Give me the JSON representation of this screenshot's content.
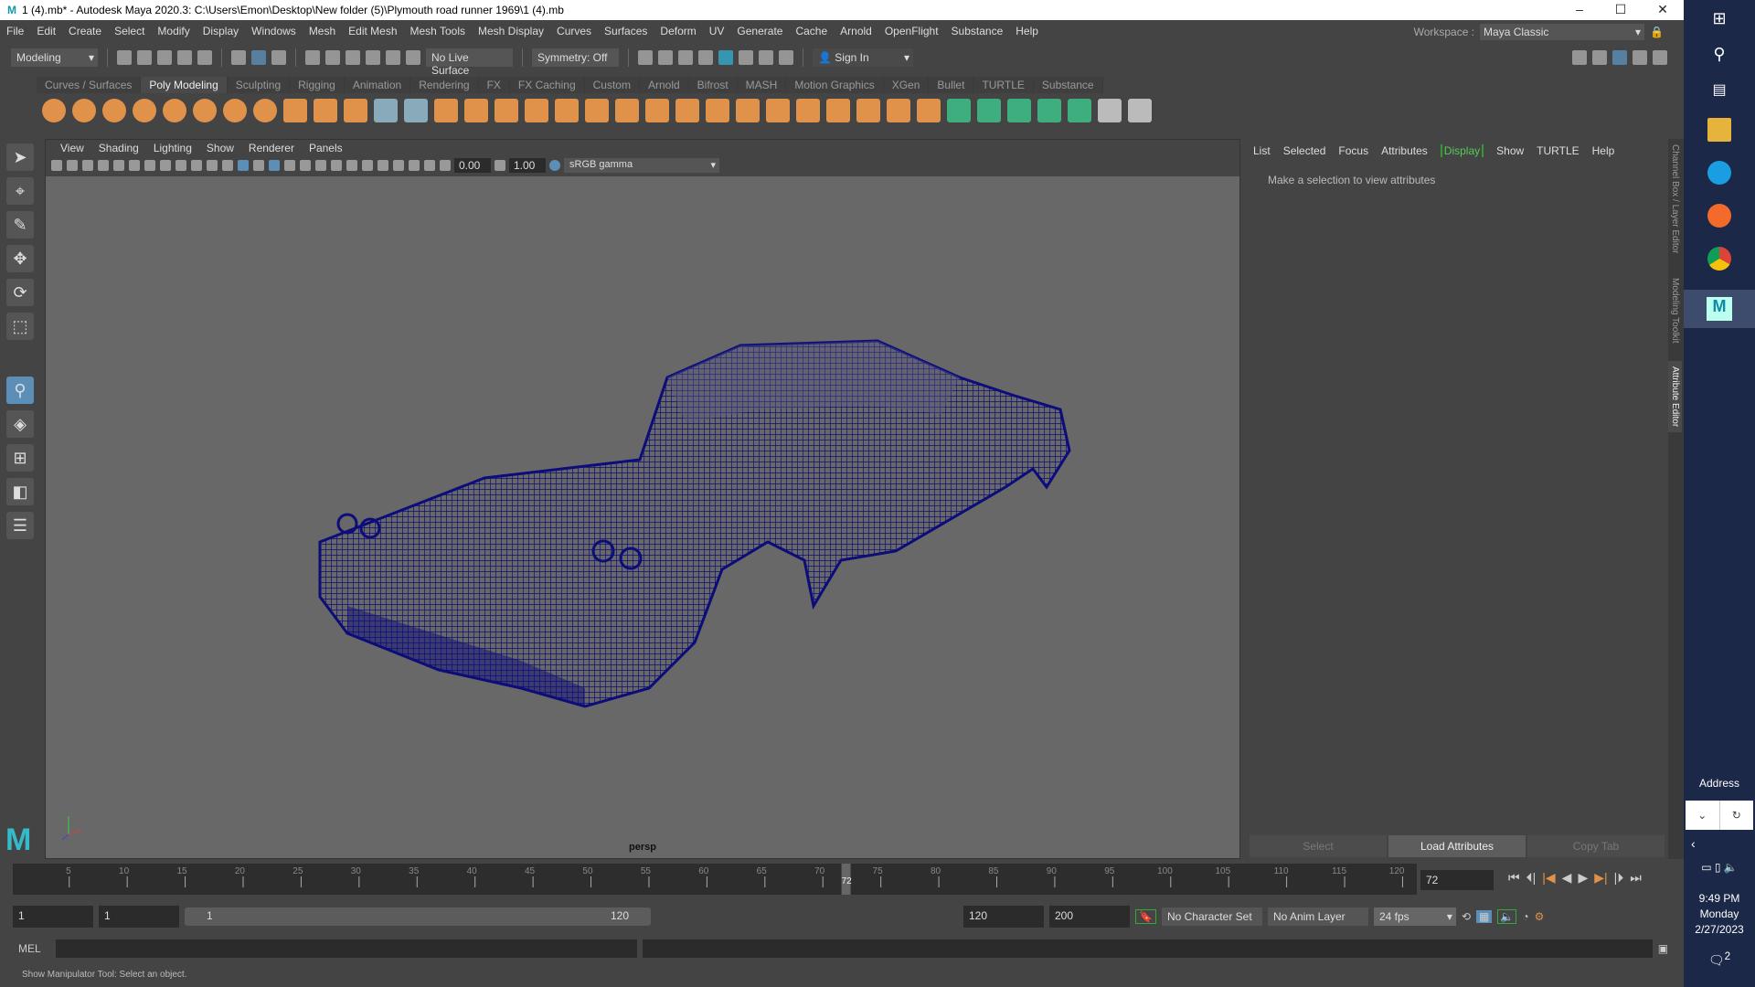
{
  "title": "1 (4).mb* - Autodesk Maya 2020.3: C:\\Users\\Emon\\Desktop\\New folder (5)\\Plymouth road runner 1969\\1 (4).mb",
  "menu": [
    "File",
    "Edit",
    "Create",
    "Select",
    "Modify",
    "Display",
    "Windows",
    "Mesh",
    "Edit Mesh",
    "Mesh Tools",
    "Mesh Display",
    "Curves",
    "Surfaces",
    "Deform",
    "UV",
    "Generate",
    "Cache",
    "Arnold",
    "OpenFlight",
    "Substance",
    "Help"
  ],
  "workspace": {
    "label": "Workspace :",
    "value": "Maya Classic"
  },
  "status": {
    "mode": "Modeling",
    "live_surface": "No Live Surface",
    "symmetry": "Symmetry: Off",
    "sign_in": "Sign In"
  },
  "shelf_tabs": [
    "Curves / Surfaces",
    "Poly Modeling",
    "Sculpting",
    "Rigging",
    "Animation",
    "Rendering",
    "FX",
    "FX Caching",
    "Custom",
    "Arnold",
    "Bifrost",
    "MASH",
    "Motion Graphics",
    "XGen",
    "Bullet",
    "TURTLE",
    "Substance"
  ],
  "shelf_active": "Poly Modeling",
  "shelf_icons": [
    "sphere",
    "cube",
    "cylinder",
    "cone",
    "torus",
    "plane",
    "disc",
    "platonic",
    "superellipse",
    "type",
    "svg",
    "measure",
    "uv-snapshot",
    "pivot",
    "combine",
    "separate",
    "extract",
    "smooth",
    "boolean",
    "mirror",
    "bridge",
    "extrude",
    "bevel",
    "fill-hole",
    "append",
    "multi-cut",
    "target-weld",
    "quad-draw",
    "uv-planar",
    "uv-cylindrical",
    "uv-spherical",
    "uv-auto",
    "uv-unfold",
    "uv-layout",
    "checker",
    "uv-cut",
    "uv-sew"
  ],
  "viewport": {
    "menu": [
      "View",
      "Shading",
      "Lighting",
      "Show",
      "Renderer",
      "Panels"
    ],
    "exposure": "0.00",
    "gamma": "1.00",
    "color_space": "sRGB gamma",
    "camera": "persp"
  },
  "attr": {
    "menu": [
      "List",
      "Selected",
      "Focus",
      "Attributes",
      "Display",
      "Show",
      "TURTLE",
      "Help"
    ],
    "active": "Display",
    "message": "Make a selection to view attributes",
    "buttons": [
      "Select",
      "Load Attributes",
      "Copy Tab"
    ]
  },
  "side_tabs": [
    "Channel Box / Layer Editor",
    "Modeling Toolkit",
    "Attribute Editor"
  ],
  "timeline": {
    "start": 1,
    "end": 120,
    "current": 72,
    "tick_labels": [
      5,
      10,
      15,
      20,
      25,
      30,
      35,
      40,
      45,
      50,
      55,
      60,
      65,
      70,
      75,
      80,
      85,
      90,
      95,
      100,
      105,
      110,
      115,
      120
    ],
    "current_field": "72"
  },
  "range": {
    "start_field": "1",
    "playback_start": "1",
    "slider_start": "1",
    "slider_end": "120",
    "playback_end": "120",
    "anim_end": "200",
    "character_set": "No Character Set",
    "anim_layer": "No Anim Layer",
    "fps": "24 fps"
  },
  "cmd": {
    "label": "MEL"
  },
  "help": "Show Manipulator Tool: Select an object.",
  "taskbar": {
    "address": "Address",
    "time": "9:49 PM",
    "day": "Monday",
    "date": "2/27/2023",
    "notifications": "2"
  },
  "colors": {
    "wire": "#0d0d7a",
    "accent": "#5b8fb8",
    "shelf_orange": "#e0924a",
    "shelf_green": "#3fae7e"
  }
}
